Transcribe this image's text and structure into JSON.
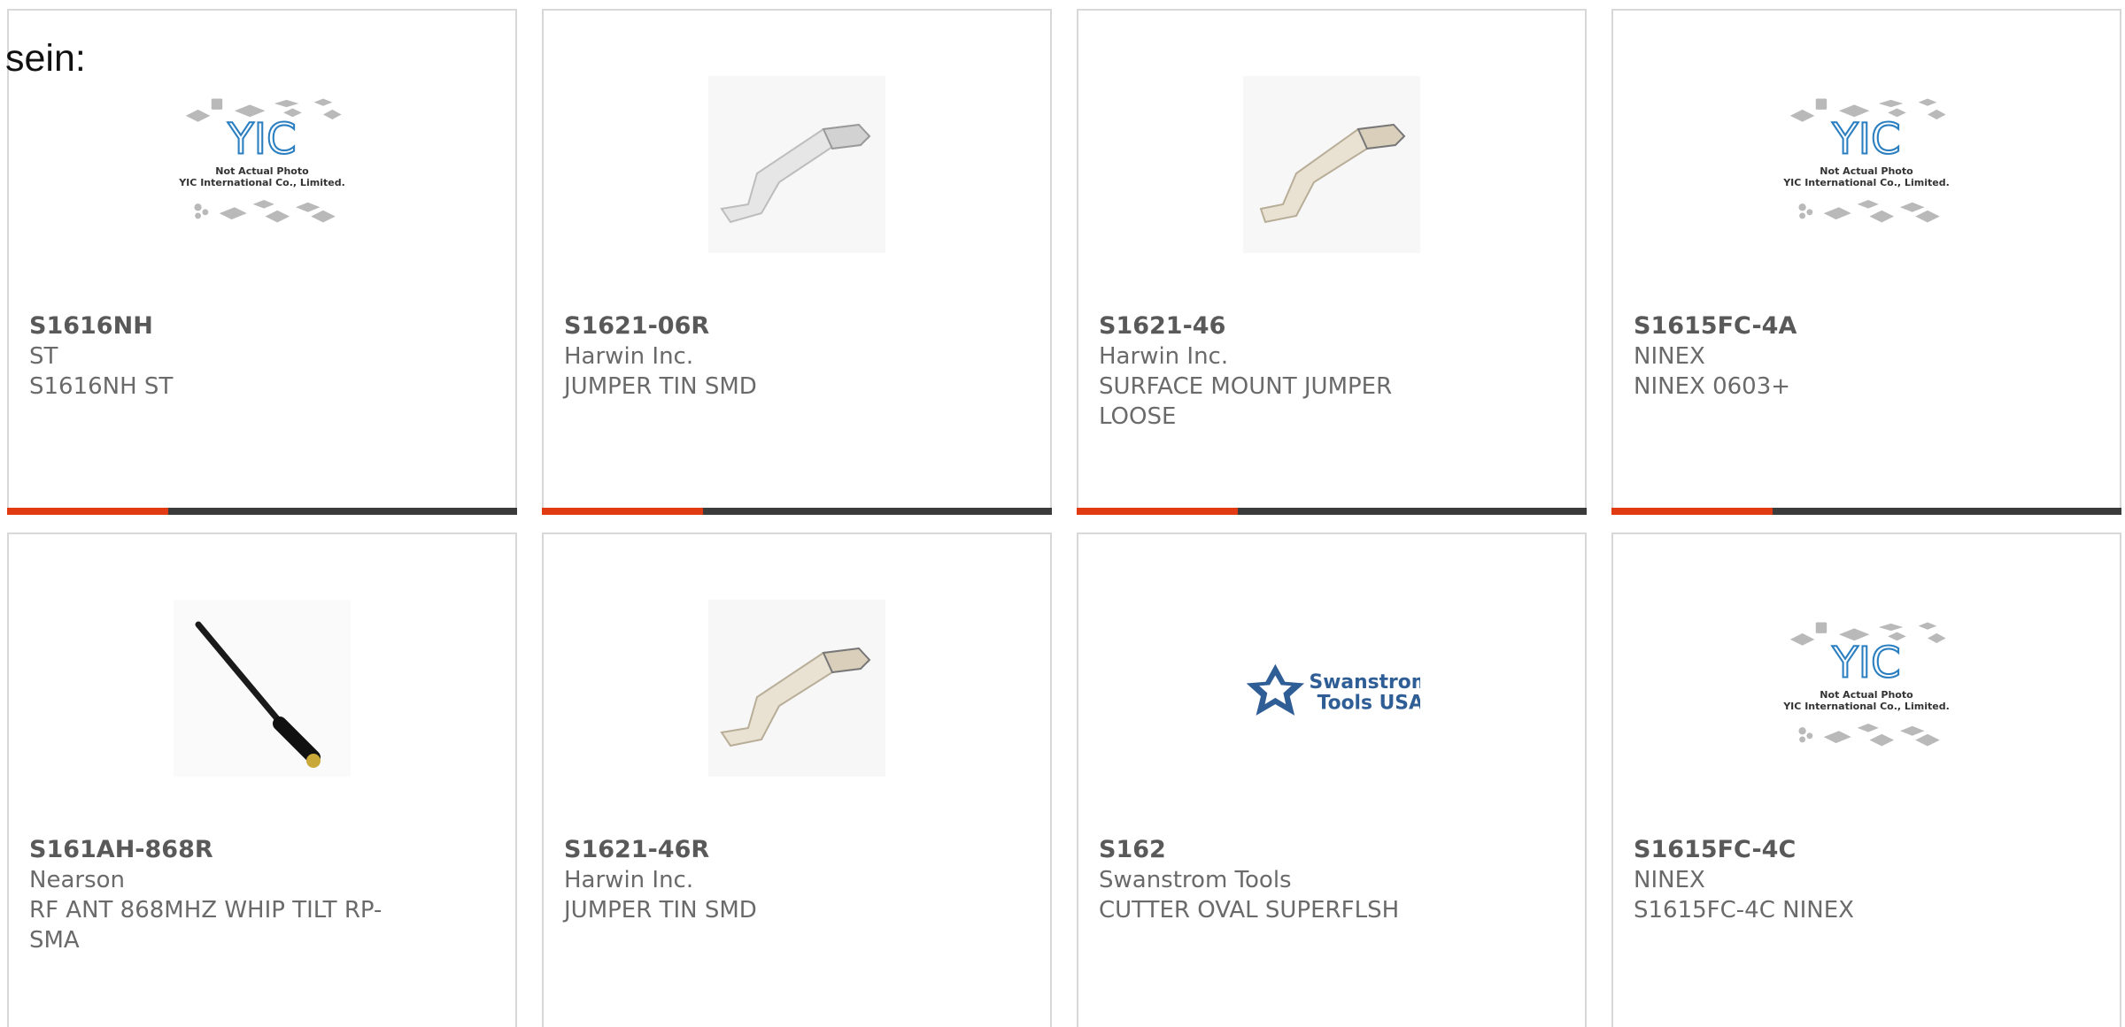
{
  "lead_text": "sein:",
  "accent_color": "#e03b12",
  "bar_color": "#3b3b3b",
  "products": [
    {
      "part": "S1616NH",
      "maker": "ST",
      "desc": "S1616NH ST",
      "image": "placeholder-logo",
      "placeholder": {
        "line1": "Not Actual Photo",
        "line2": "YIC International Co., Limited."
      }
    },
    {
      "part": "S1621-06R",
      "maker": "Harwin Inc.",
      "desc": "JUMPER TIN SMD",
      "image": "jumper-silver"
    },
    {
      "part": "S1621-46",
      "maker": "Harwin Inc.",
      "desc": "SURFACE MOUNT JUMPER LOOSE",
      "image": "jumper-beige"
    },
    {
      "part": "S1615FC-4A",
      "maker": "NINEX",
      "desc": "NINEX 0603+",
      "image": "placeholder-logo",
      "placeholder": {
        "line1": "Not Actual Photo",
        "line2": "YIC International Co., Limited."
      }
    },
    {
      "part": "S161AH-868R",
      "maker": "Nearson",
      "desc": "RF ANT 868MHZ WHIP TILT RP-SMA",
      "image": "antenna"
    },
    {
      "part": "S1621-46R",
      "maker": "Harwin Inc.",
      "desc": "JUMPER TIN SMD",
      "image": "jumper-beige"
    },
    {
      "part": "S162",
      "maker": "Swanstrom Tools",
      "desc": "CUTTER OVAL SUPERFLSH",
      "image": "swanstrom-logo",
      "logo": {
        "line1": "Swanstrom",
        "line2": "Tools USA"
      }
    },
    {
      "part": "S1615FC-4C",
      "maker": "NINEX",
      "desc": "S1615FC-4C NINEX",
      "image": "placeholder-logo",
      "placeholder": {
        "line1": "Not Actual Photo",
        "line2": "YIC International Co., Limited."
      }
    }
  ]
}
